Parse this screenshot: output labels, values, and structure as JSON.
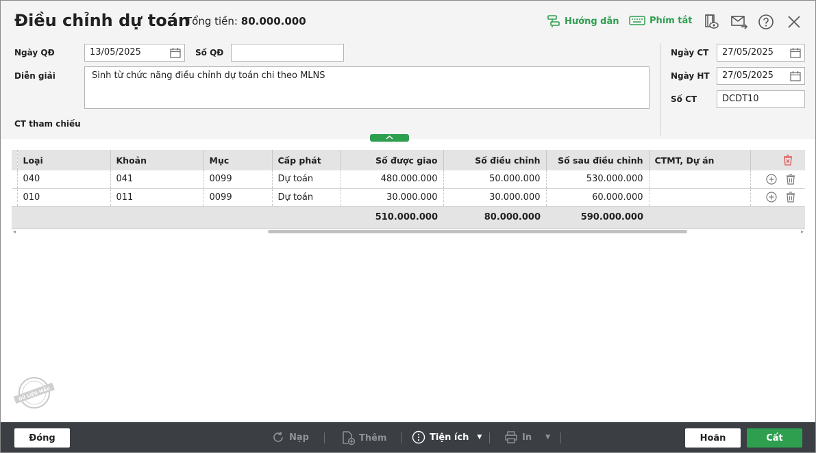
{
  "header": {
    "title": "Điều chỉnh dự toán",
    "total_label": "Tổng tiền:",
    "total_value": "80.000.000",
    "guide_label": "Hướng dẫn",
    "shortcut_label": "Phím tắt"
  },
  "form": {
    "decision_date_label": "Ngày QĐ",
    "decision_date_value": "13/05/2025",
    "decision_no_label": "Số QĐ",
    "decision_no_value": "",
    "description_label": "Diễn giải",
    "description_value": "Sinh từ chức năng điều chỉnh dự toán chi theo MLNS",
    "reference_label": "CT tham chiếu",
    "voucher_date_label": "Ngày CT",
    "voucher_date_value": "27/05/2025",
    "posting_date_label": "Ngày HT",
    "posting_date_value": "27/05/2025",
    "voucher_no_label": "Số CT",
    "voucher_no_value": "DCDT10"
  },
  "grid": {
    "columns": [
      "Loại",
      "Khoản",
      "Mục",
      "Cấp phát",
      "Số được giao",
      "Số điều chỉnh",
      "Số sau điều chỉnh",
      "CTMT, Dự án"
    ],
    "rows": [
      {
        "loai": "040",
        "khoan": "041",
        "muc": "0099",
        "cap_phat": "Dự toán",
        "so_duoc_giao": "480.000.000",
        "so_dieu_chinh": "50.000.000",
        "so_sau_dieu_chinh": "530.000.000",
        "ctmt": ""
      },
      {
        "loai": "010",
        "khoan": "011",
        "muc": "0099",
        "cap_phat": "Dự toán",
        "so_duoc_giao": "30.000.000",
        "so_dieu_chinh": "30.000.000",
        "so_sau_dieu_chinh": "60.000.000",
        "ctmt": ""
      }
    ],
    "totals": {
      "so_duoc_giao": "510.000.000",
      "so_dieu_chinh": "80.000.000",
      "so_sau_dieu_chinh": "590.000.000"
    }
  },
  "footer": {
    "close_label": "Đóng",
    "reload_label": "Nạp",
    "add_label": "Thêm",
    "utilities_label": "Tiện ích",
    "print_label": "In",
    "cancel_label": "Hoãn",
    "save_label": "Cất"
  },
  "stamp_text": "DỮ LIỆU MẪU",
  "colors": {
    "accent": "#2e9e4f",
    "footer_bg": "#3b3f44",
    "header_bg": "#f4f4f4",
    "delete_red": "#e05555"
  }
}
